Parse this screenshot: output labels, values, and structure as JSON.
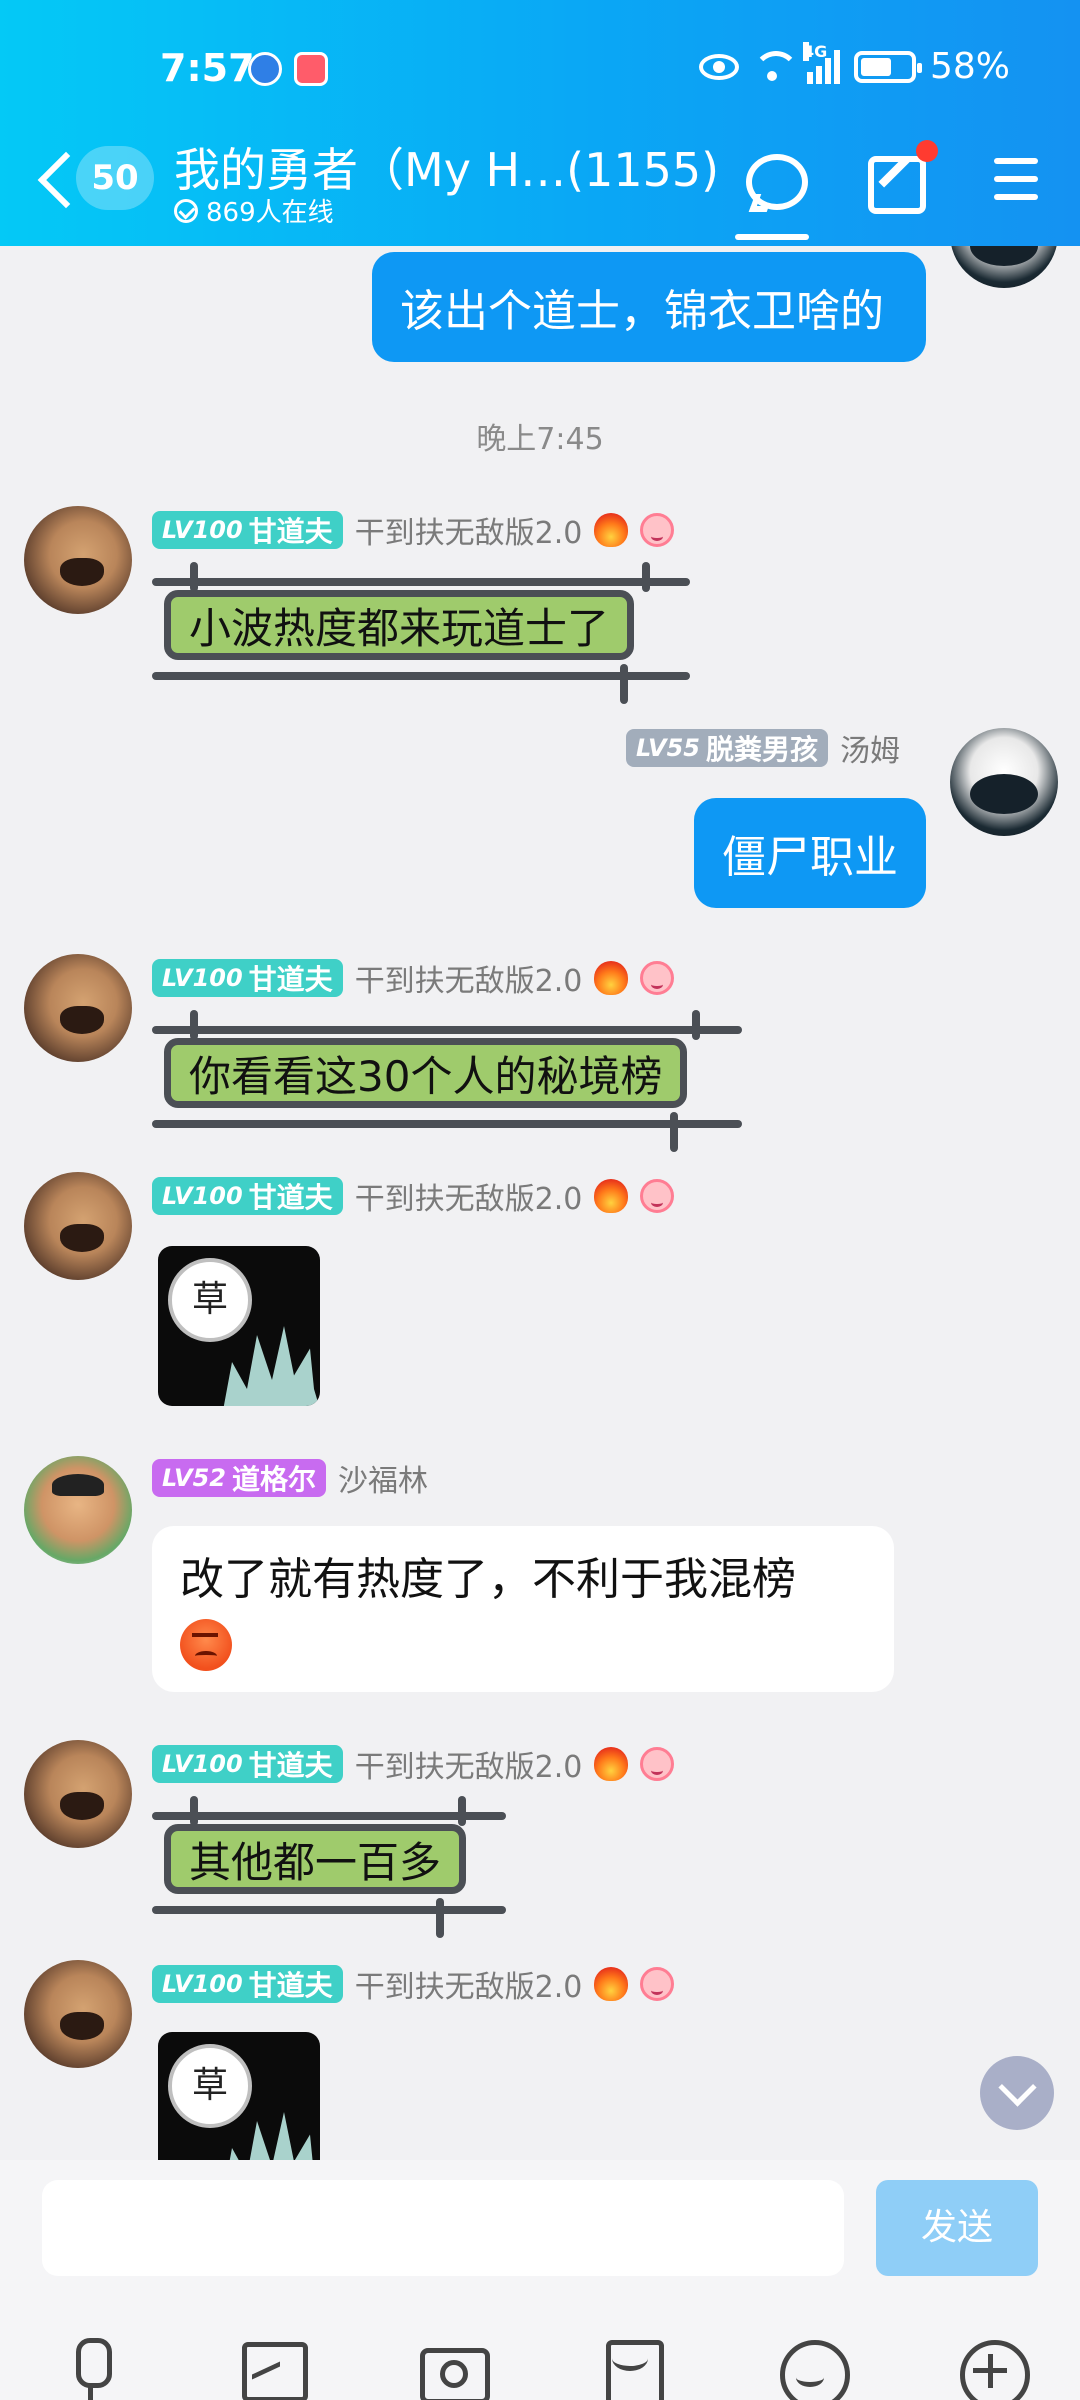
{
  "status_bar": {
    "time": "7:57",
    "network": "4G",
    "battery": "58%"
  },
  "header": {
    "unread_count": "50",
    "title": "我的勇者（My H…(1155)",
    "online": "869人在线"
  },
  "messages": {
    "time_separator": "晚上7:45",
    "m0": {
      "text": "该出个道士，锦衣卫啥的"
    },
    "m1": {
      "lv": "LV100",
      "badge": "甘道夫",
      "nick": "干到扶无敌版2.0",
      "text": "小波热度都来玩道士了"
    },
    "m2": {
      "lv": "LV55",
      "badge": "脱粪男孩",
      "nick": "汤姆",
      "text": "僵尸职业"
    },
    "m3": {
      "lv": "LV100",
      "badge": "甘道夫",
      "nick": "干到扶无敌版2.0",
      "text": "你看看这30个人的秘境榜"
    },
    "m4": {
      "lv": "LV100",
      "badge": "甘道夫",
      "nick": "干到扶无敌版2.0",
      "sticker_text": "草"
    },
    "m5": {
      "lv": "LV52",
      "badge": "道格尔",
      "nick": "沙福林",
      "text": "改了就有热度了，不利于我混榜"
    },
    "m6": {
      "lv": "LV100",
      "badge": "甘道夫",
      "nick": "干到扶无敌版2.0",
      "text": "其他都一百多"
    },
    "m7": {
      "lv": "LV100",
      "badge": "甘道夫",
      "nick": "干到扶无敌版2.0",
      "sticker_text": "草"
    }
  },
  "input_bar": {
    "placeholder": "",
    "send_label": "发送"
  },
  "toolbar_icons": [
    "mic-icon",
    "image-icon",
    "camera-icon",
    "red-packet-icon",
    "emoji-icon",
    "plus-icon"
  ]
}
